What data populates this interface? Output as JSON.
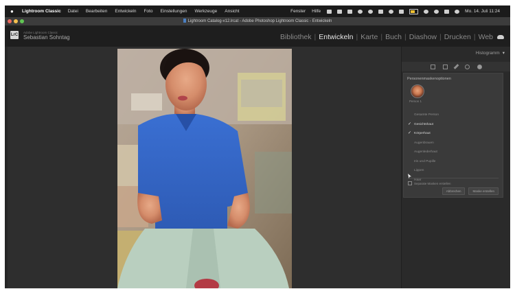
{
  "menubar": {
    "app_name": "Lightroom Classic",
    "menus": [
      "Datei",
      "Bearbeiten",
      "Entwickeln",
      "Foto",
      "Einstellungen",
      "Werkzeuge",
      "Ansicht"
    ],
    "right_menus": [
      "Fenster",
      "Hilfe"
    ],
    "datetime": "Mo. 14. Juli 11:24"
  },
  "window": {
    "title": "Lightroom Catalog-v12.lrcat - Adobe Photoshop Lightroom Classic - Entwickeln"
  },
  "identity": {
    "logo": "LrC",
    "small_text": "Adobe Lightroom Classic",
    "name": "Sebastian Sohntag"
  },
  "modules": {
    "items": [
      "Bibliothek",
      "Entwickeln",
      "Karte",
      "Buch",
      "Diashow",
      "Drucken",
      "Web"
    ],
    "active": "Entwickeln"
  },
  "panel": {
    "histogram_label": "Histogramm",
    "mask_title": "Personenmaskenoptionen",
    "person_label": "Person 1",
    "options": [
      {
        "label": "Gesamte Person",
        "checked": false
      },
      {
        "label": "Gesichtshaut",
        "checked": true
      },
      {
        "label": "Körperhaut",
        "checked": true
      },
      {
        "label": "Augenbrauen",
        "checked": false
      },
      {
        "label": "Augenlederhaut",
        "checked": false
      },
      {
        "label": "Iris und Pupille",
        "checked": false
      },
      {
        "label": "Lippen",
        "checked": false
      },
      {
        "label": "Haar",
        "checked": false
      }
    ],
    "footer_checkbox": "Separate Masken erstellen",
    "btn_cancel": "Abbrechen",
    "btn_create": "Maske erstellen"
  }
}
